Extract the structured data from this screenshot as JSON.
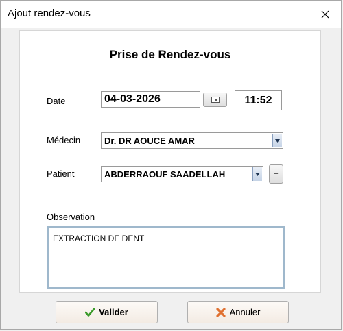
{
  "window": {
    "title": "Ajout rendez-vous"
  },
  "form": {
    "heading": "Prise de Rendez-vous",
    "date_label": "Date",
    "date_value": "04-03-2026",
    "time_value": "11:52",
    "medecin_label": "Médecin",
    "medecin_value": "Dr. DR AOUCE AMAR",
    "patient_label": "Patient",
    "patient_value": "ABDERRAOUF SAADELLAH",
    "add_patient_label": "+",
    "observation_label": "Observation",
    "observation_value": "EXTRACTION DE DENT"
  },
  "actions": {
    "validate_label": "Valider",
    "cancel_label": "Annuler"
  },
  "colors": {
    "validate_icon": "#3a9a2a",
    "cancel_icon": "#e07030"
  }
}
